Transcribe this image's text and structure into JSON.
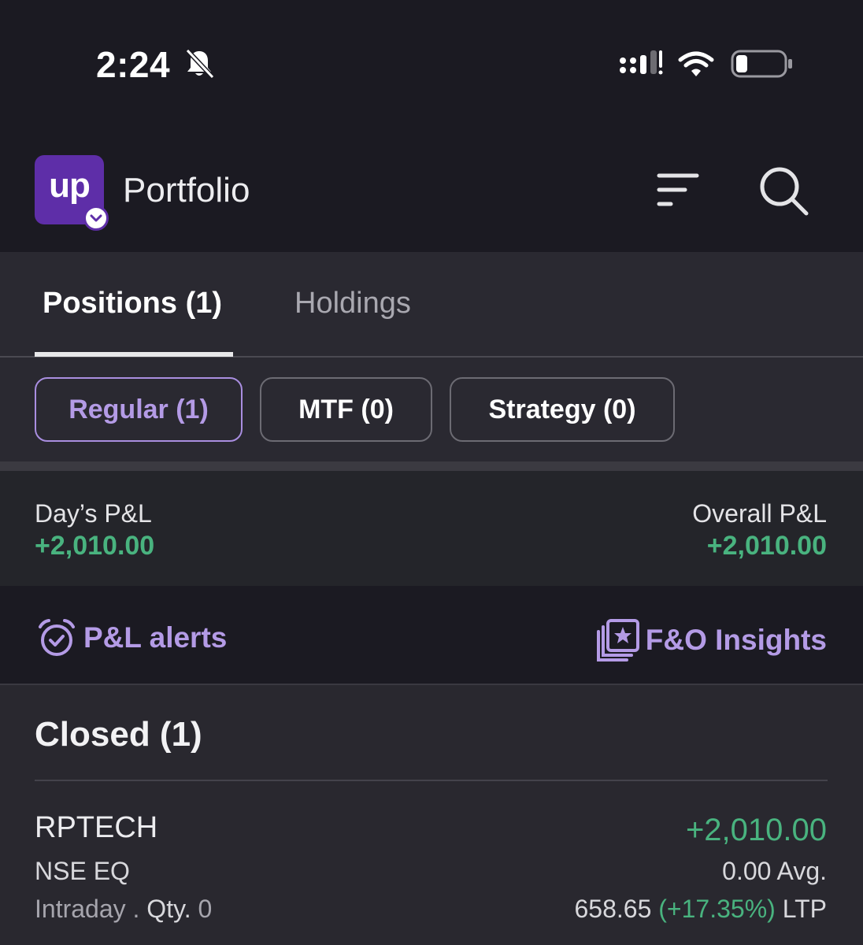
{
  "status_bar": {
    "time": "2:24",
    "icons": [
      "bell-muted-icon",
      "cellular-signal-icon",
      "wifi-icon",
      "battery-icon"
    ]
  },
  "header": {
    "logo_text": "up",
    "title": "Portfolio",
    "icons": [
      "filter-icon",
      "search-icon"
    ]
  },
  "tabs": [
    {
      "label": "Positions (1)",
      "active": true
    },
    {
      "label": "Holdings",
      "active": false
    }
  ],
  "filters": [
    {
      "label": "Regular (1)",
      "selected": true
    },
    {
      "label": "MTF (0)",
      "selected": false
    },
    {
      "label": "Strategy (0)",
      "selected": false
    }
  ],
  "pnl_summary": {
    "day_label": "Day’s P&L",
    "day_value": "+2,010.00",
    "overall_label": "Overall P&L",
    "overall_value": "+2,010.00"
  },
  "tools": {
    "alerts_label": "P&L alerts",
    "insights_label": "F&O Insights"
  },
  "closed": {
    "title": "Closed (1)",
    "positions": [
      {
        "symbol": "RPTECH",
        "exchange": "NSE EQ",
        "product": "Intraday .",
        "qty_label": "Qty.",
        "qty": "0",
        "pnl": "+2,010.00",
        "avg": "0.00 Avg.",
        "ltp_price": "658.65",
        "ltp_change": "(+17.35%)",
        "ltp_label": "LTP"
      }
    ]
  },
  "colors": {
    "background": "#1b1a22",
    "panel": "#2a2931",
    "accent_purple": "#b49be6",
    "brand_purple": "#5e2ea8",
    "profit_green": "#49b37f"
  }
}
